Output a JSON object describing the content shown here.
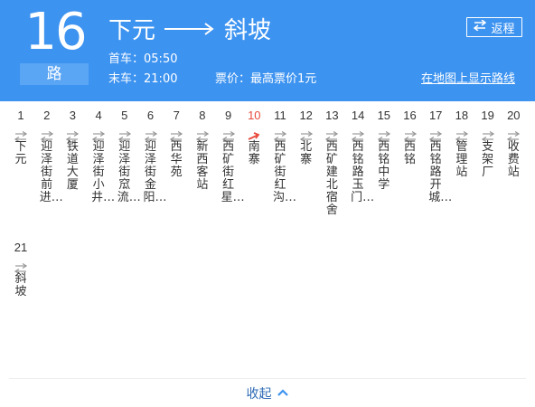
{
  "route": {
    "number": "16",
    "suffix": "路"
  },
  "header": {
    "origin": "下元",
    "destination": "斜坡",
    "first_bus_label": "首车：",
    "first_bus_time": "05:50",
    "last_bus_label": "末车：",
    "last_bus_time": "21:00",
    "fare_label": "票价：",
    "fare_text": "最高票价1元",
    "return_label": "返程",
    "map_link": "在地图上显示路线"
  },
  "stops": [
    {
      "num": "1",
      "name": "下元",
      "active": false
    },
    {
      "num": "2",
      "name": "迎泽街前进…",
      "active": false
    },
    {
      "num": "3",
      "name": "铁道大厦",
      "active": false
    },
    {
      "num": "4",
      "name": "迎泽街小井…",
      "active": false
    },
    {
      "num": "5",
      "name": "迎泽街窊流…",
      "active": false
    },
    {
      "num": "6",
      "name": "迎泽街金阳…",
      "active": false
    },
    {
      "num": "7",
      "name": "西华苑",
      "active": false
    },
    {
      "num": "8",
      "name": "新西客站",
      "active": false
    },
    {
      "num": "9",
      "name": "西矿街红星…",
      "active": false
    },
    {
      "num": "10",
      "name": "南寨",
      "active": true
    },
    {
      "num": "11",
      "name": "西矿街红沟…",
      "active": false
    },
    {
      "num": "12",
      "name": "北寨",
      "active": false
    },
    {
      "num": "13",
      "name": "西矿建北宿舍",
      "active": false
    },
    {
      "num": "14",
      "name": "西铭路玉门…",
      "active": false
    },
    {
      "num": "15",
      "name": "西铭中学",
      "active": false
    },
    {
      "num": "16",
      "name": "西铭",
      "active": false
    },
    {
      "num": "17",
      "name": "西铭路开城…",
      "active": false
    },
    {
      "num": "18",
      "name": "管理站",
      "active": false
    },
    {
      "num": "19",
      "name": "支架厂",
      "active": false
    },
    {
      "num": "20",
      "name": "收费站",
      "active": false
    },
    {
      "num": "21",
      "name": "斜坡",
      "active": false
    }
  ],
  "footer": {
    "collapse_label": "收起"
  },
  "colors": {
    "header_bg": "#3d93f0",
    "active_stop": "#e84a3c",
    "link": "#2f6bb5"
  }
}
